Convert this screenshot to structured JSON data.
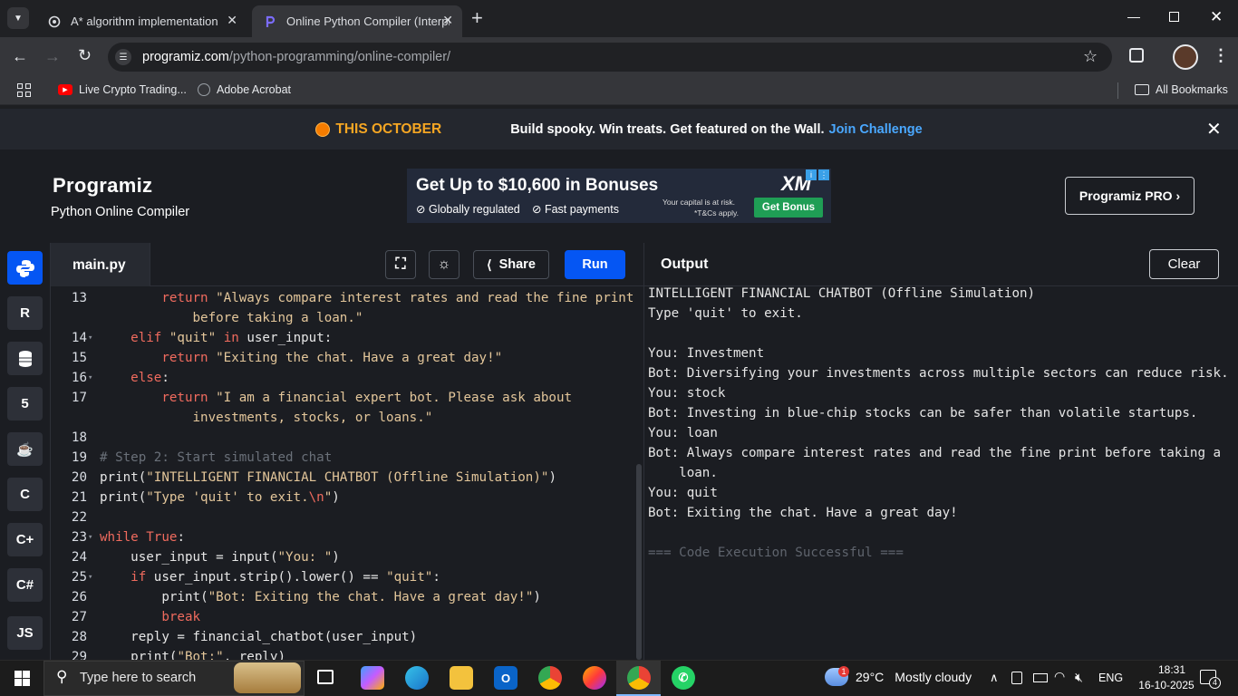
{
  "browser": {
    "tabs": [
      {
        "title": "A* algorithm implementation",
        "active": false
      },
      {
        "title": "Online Python Compiler (Interpre",
        "active": true
      }
    ],
    "url_host": "programiz.com",
    "url_path": "/python-programming/online-compiler/",
    "bookmarks": [
      "Live Crypto Trading...",
      "Adobe Acrobat"
    ],
    "all_bookmarks": "All Bookmarks"
  },
  "promo": {
    "badge": "THIS OCTOBER",
    "text": "Build spooky. Win treats. Get featured on the Wall.",
    "link": "Join Challenge"
  },
  "header": {
    "logo": "Programiz",
    "subtitle": "Python Online Compiler",
    "ad_title": "Get Up to $10,600 in Bonuses",
    "ad_feature1": "Globally regulated",
    "ad_feature2": "Fast payments",
    "ad_risk": "Your capital is at risk.",
    "ad_tcs": "*T&Cs apply.",
    "ad_button": "Get Bonus",
    "ad_brand": "XM",
    "pro_button": "Programiz PRO ›"
  },
  "sidebar": {
    "js_label": "JS"
  },
  "editor": {
    "filename": "main.py",
    "share_label": "Share",
    "run_label": "Run",
    "lines": [
      {
        "n": "13",
        "fold": false,
        "html": "        <span class='kw'>return</span> <span class='str'>\"Always compare interest rates and read the fine print</span>"
      },
      {
        "n": "",
        "fold": false,
        "html": "            <span class='str'>before taking a loan.\"</span>"
      },
      {
        "n": "14",
        "fold": true,
        "html": "    <span class='kw'>elif</span> <span class='str'>\"quit\"</span> <span class='kw'>in</span> user_input:"
      },
      {
        "n": "15",
        "fold": false,
        "html": "        <span class='kw'>return</span> <span class='str'>\"Exiting the chat. Have a great day!\"</span>"
      },
      {
        "n": "16",
        "fold": true,
        "html": "    <span class='kw'>else</span>:"
      },
      {
        "n": "17",
        "fold": false,
        "html": "        <span class='kw'>return</span> <span class='str'>\"I am a financial expert bot. Please ask about</span>"
      },
      {
        "n": "",
        "fold": false,
        "html": "            <span class='str'>investments, stocks, or loans.\"</span>"
      },
      {
        "n": "18",
        "fold": false,
        "html": ""
      },
      {
        "n": "19",
        "fold": false,
        "html": "<span class='cm'># Step 2: Start simulated chat</span>"
      },
      {
        "n": "20",
        "fold": false,
        "html": "<span class='fn'>print</span>(<span class='str'>\"INTELLIGENT FINANCIAL CHATBOT (Offline Simulation)\"</span>)"
      },
      {
        "n": "21",
        "fold": false,
        "html": "<span class='fn'>print</span>(<span class='str'>\"Type 'quit' to exit.</span><span class='esc'>\\n</span><span class='str'>\"</span>)"
      },
      {
        "n": "22",
        "fold": false,
        "html": ""
      },
      {
        "n": "23",
        "fold": true,
        "html": "<span class='kw'>while</span> <span class='kw'>True</span>:"
      },
      {
        "n": "24",
        "fold": false,
        "html": "    user_input = <span class='fn'>input</span>(<span class='str'>\"You: \"</span>)"
      },
      {
        "n": "25",
        "fold": true,
        "html": "    <span class='kw'>if</span> user_input.strip().lower() == <span class='str'>\"quit\"</span>:"
      },
      {
        "n": "26",
        "fold": false,
        "html": "        <span class='fn'>print</span>(<span class='str'>\"Bot: Exiting the chat. Have a great day!\"</span>)"
      },
      {
        "n": "27",
        "fold": false,
        "html": "        <span class='kw'>break</span>"
      },
      {
        "n": "28",
        "fold": false,
        "html": "    reply = financial_chatbot(user_input)"
      },
      {
        "n": "29",
        "fold": false,
        "html": "    <span class='fn'>print</span>(<span class='str'>\"Bot:\"</span>, reply)"
      }
    ]
  },
  "output": {
    "title": "Output",
    "clear_label": "Clear",
    "lines": [
      "INTELLIGENT FINANCIAL CHATBOT (Offline Simulation)",
      "Type 'quit' to exit.",
      "",
      "You: Investment",
      "Bot: Diversifying your investments across multiple sectors can reduce risk.",
      "You: stock",
      "Bot: Investing in blue-chip stocks can be safer than volatile startups.",
      "You: loan",
      "Bot: Always compare interest rates and read the fine print before taking a",
      "    loan.",
      "You: quit",
      "Bot: Exiting the chat. Have a great day!",
      "",
      "=== Code Execution Successful ==="
    ]
  },
  "taskbar": {
    "search_placeholder": "Type here to search",
    "weather_temp": "29°C",
    "weather_text": "Mostly cloudy",
    "lang": "ENG",
    "time": "18:31",
    "date": "16-10-2025",
    "notif_count": "4",
    "weather_badge": "1"
  },
  "colors": {
    "run": "#0556f3",
    "promo_orange": "#f5a623",
    "link": "#4aa8ff",
    "ad_green": "#1f9e55"
  }
}
